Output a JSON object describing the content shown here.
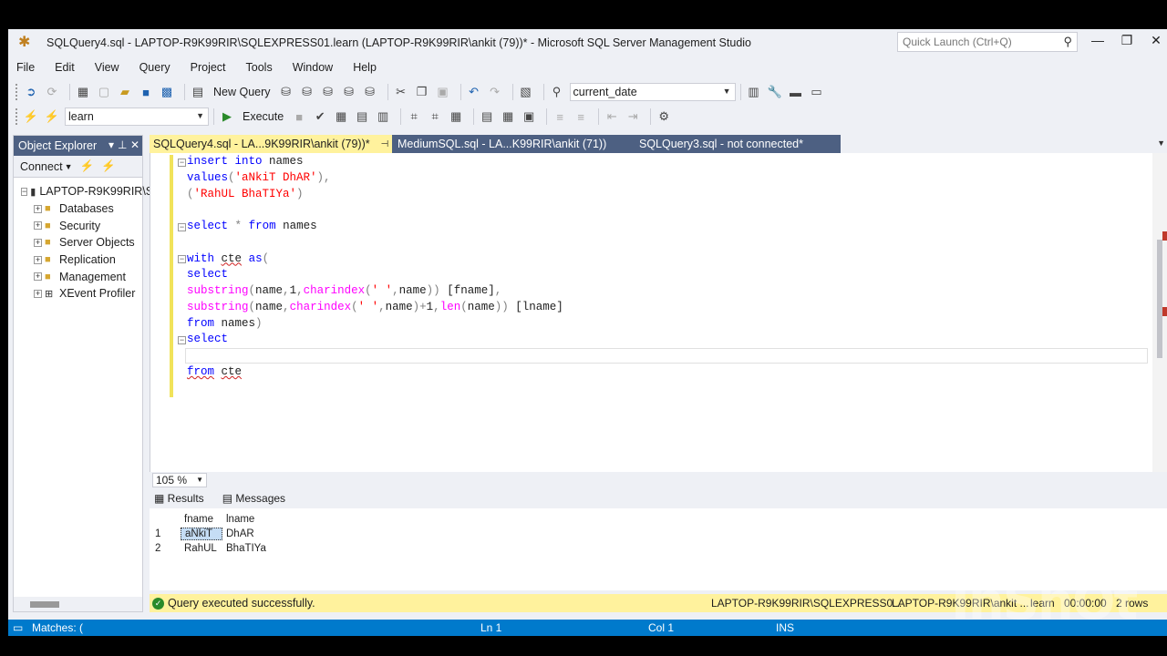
{
  "window": {
    "title": "SQLQuery4.sql - LAPTOP-R9K99RIR\\SQLEXPRESS01.learn (LAPTOP-R9K99RIR\\ankit (79))* - Microsoft SQL Server Management Studio",
    "quick_launch_placeholder": "Quick Launch (Ctrl+Q)"
  },
  "menu": [
    "File",
    "Edit",
    "View",
    "Query",
    "Project",
    "Tools",
    "Window",
    "Help"
  ],
  "toolbar": {
    "new_query": "New Query",
    "search_combo": "current_date",
    "database_combo": "learn",
    "execute": "Execute"
  },
  "object_explorer": {
    "title": "Object Explorer",
    "connect": "Connect",
    "server": "LAPTOP-R9K99RIR\\S",
    "items": [
      "Databases",
      "Security",
      "Server Objects",
      "Replication",
      "Management",
      "XEvent Profiler"
    ]
  },
  "tabs": [
    {
      "label": "SQLQuery4.sql - LA...9K99RIR\\ankit (79))*",
      "active": true
    },
    {
      "label": "MediumSQL.sql - LA...K99RIR\\ankit (71))",
      "active": false
    },
    {
      "label": "SQLQuery3.sql - not connected*",
      "active": false
    }
  ],
  "editor": {
    "lines": [
      "insert into names",
      "values('aNkiT DhAR'),",
      "('RahUL BhaTIYa')",
      "",
      "select * from names",
      "",
      "with cte as(",
      "select",
      "substring(name,1,charindex(' ',name)) [fname],",
      "substring(name,charindex(' ',name)+1,len(name)) [lname]",
      "from names)",
      "select",
      "",
      "from cte"
    ],
    "zoom": "105 %"
  },
  "results": {
    "tab_results": "Results",
    "tab_messages": "Messages",
    "columns": [
      "fname",
      "lname"
    ],
    "rows": [
      {
        "num": "1",
        "fname": "aNkiT",
        "lname": "DhAR"
      },
      {
        "num": "2",
        "fname": "RahUL",
        "lname": "BhaTIYa"
      }
    ]
  },
  "query_status": {
    "message": "Query executed successfully.",
    "server": "LAPTOP-R9K99RIR\\SQLEXPRESS0...",
    "user": "LAPTOP-R9K99RIR\\ankit ...",
    "database": "learn",
    "elapsed": "00:00:00",
    "rows": "2 rows"
  },
  "ide_status": {
    "matches": "Matches: (",
    "ln": "Ln 1",
    "col": "Col 1",
    "mode": "INS"
  },
  "watermark": "InShOt"
}
